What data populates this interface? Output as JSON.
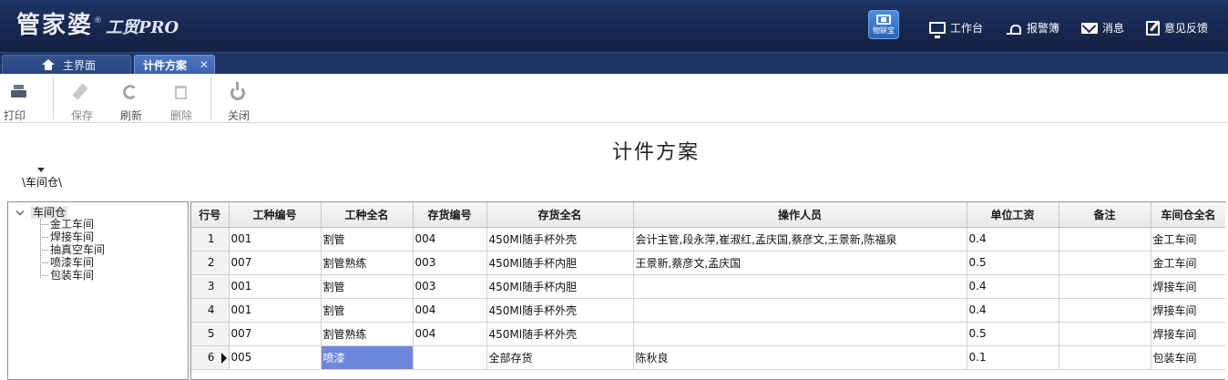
{
  "app": {
    "logo_main": "管家婆",
    "logo_tm": "®",
    "logo_sub": "工贸PRO",
    "iot_label": "物联宝"
  },
  "topnav": [
    {
      "label": "工作台",
      "icon": "monitor-icon"
    },
    {
      "label": "报警簿",
      "icon": "alarm-icon"
    },
    {
      "label": "消息",
      "icon": "mail-icon"
    },
    {
      "label": "意见反馈",
      "icon": "feedback-icon"
    }
  ],
  "tabs": {
    "home": "主界面",
    "active": "计件方案",
    "close": "✕"
  },
  "toolbar": {
    "print": "打印",
    "save": "保存",
    "refresh": "刷新",
    "delete": "删除",
    "close": "关闭"
  },
  "page": {
    "title": "计件方案",
    "breadcrumb": "\\车间仓\\"
  },
  "tree": {
    "root": "车间仓",
    "children": [
      "金工车间",
      "焊接车间",
      "抽真空车间",
      "喷漆车间",
      "包装车间"
    ]
  },
  "grid": {
    "columns": [
      "行号",
      "工种编号",
      "工种全名",
      "存货编号",
      "存货全名",
      "操作人员",
      "单位工资",
      "备注",
      "车间仓全名"
    ],
    "rows": [
      [
        "1",
        "001",
        "割管",
        "004",
        "450Ml随手杯外壳",
        "会计主管,段永萍,崔淑红,孟庆国,蔡彦文,王景新,陈福泉",
        "0.4",
        "",
        "金工车间"
      ],
      [
        "2",
        "007",
        "割管熟练",
        "003",
        "450Ml随手杯内胆",
        "王景新,蔡彦文,孟庆国",
        "0.5",
        "",
        "金工车间"
      ],
      [
        "3",
        "001",
        "割管",
        "003",
        "450Ml随手杯内胆",
        "",
        "0.4",
        "",
        "焊接车间"
      ],
      [
        "4",
        "001",
        "割管",
        "004",
        "450Ml随手杯外壳",
        "",
        "0.4",
        "",
        "焊接车间"
      ],
      [
        "5",
        "007",
        "割管熟练",
        "004",
        "450Ml随手杯外壳",
        "",
        "0.5",
        "",
        "焊接车间"
      ],
      [
        "6",
        "005",
        "喷漆",
        "",
        "全部存货",
        "陈秋良",
        "0.1",
        "",
        "包装车间"
      ]
    ],
    "current_row": 5,
    "selected_cell": [
      5,
      2
    ]
  },
  "colors": {
    "titlebar": "#17284f",
    "tab_active": "#3b62ad",
    "selected_cell": "#6e87dc"
  }
}
